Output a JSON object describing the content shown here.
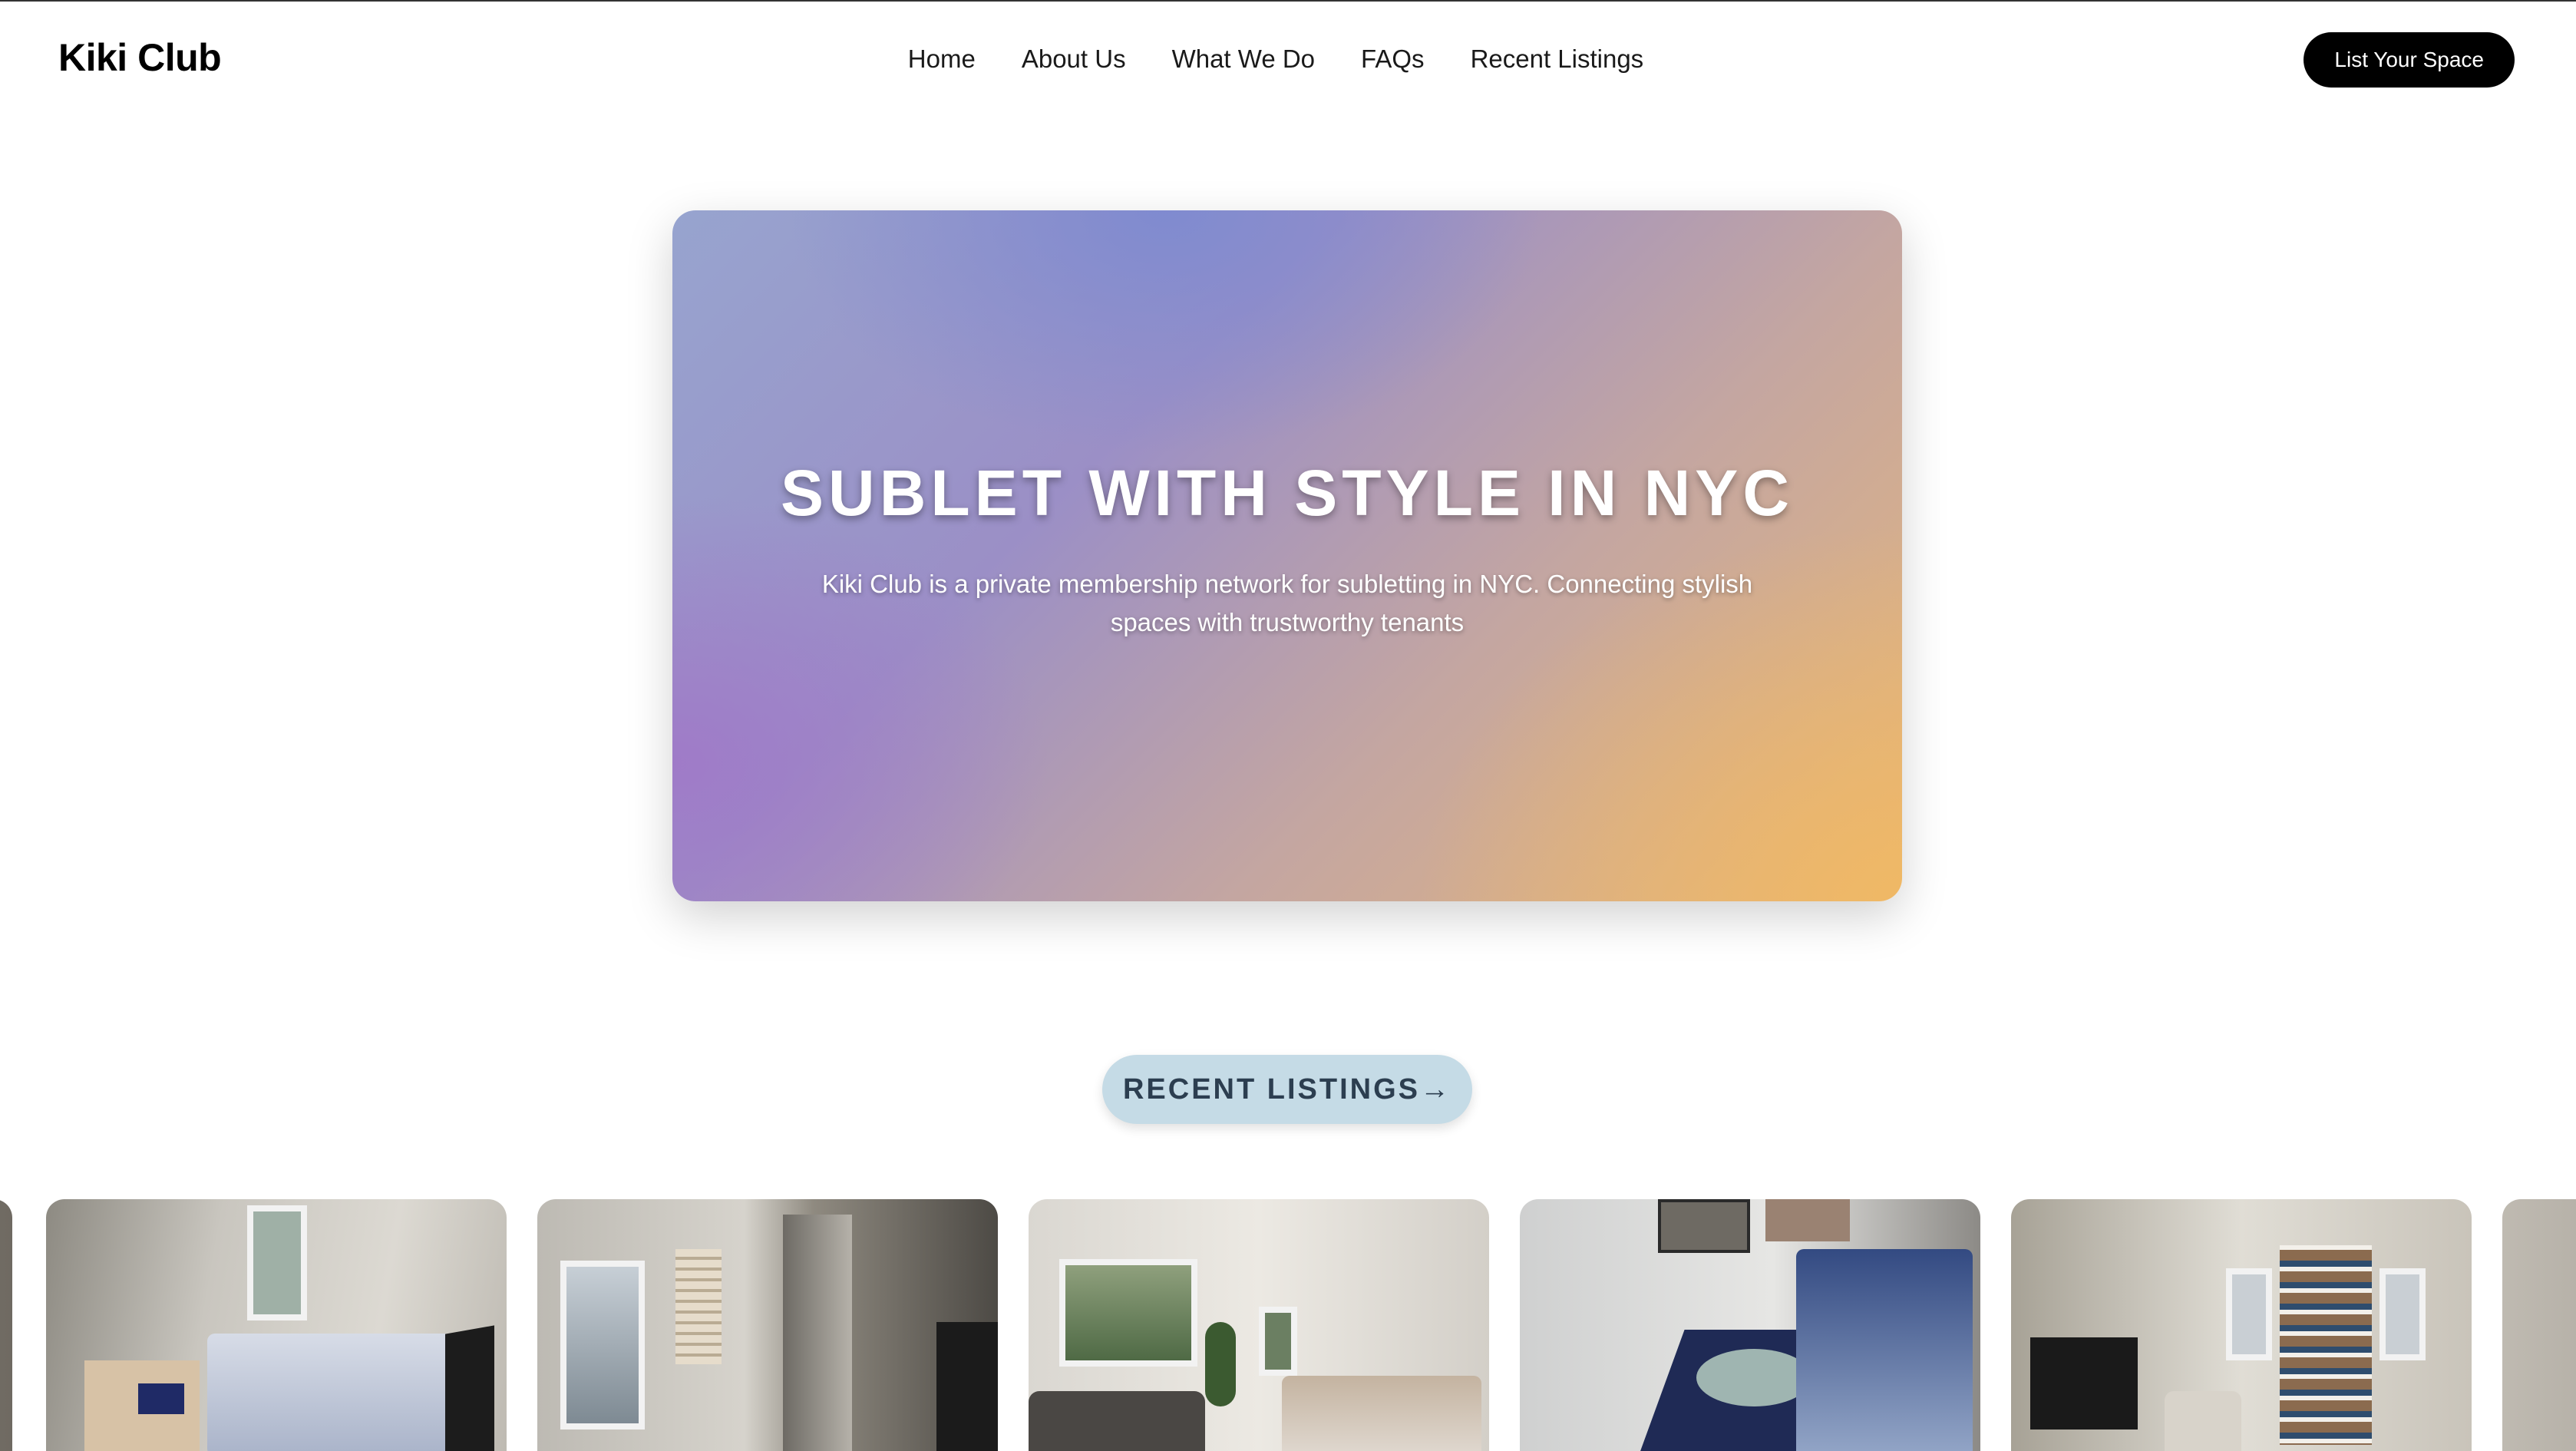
{
  "header": {
    "logo": "Kiki Club",
    "nav": [
      "Home",
      "About Us",
      "What We Do",
      "FAQs",
      "Recent Listings"
    ],
    "cta_label": "List Your Space"
  },
  "hero": {
    "title": "SUBLET WITH STYLE IN NYC",
    "subtitle": "Kiki Club is a private membership network for subletting in NYC. Connecting stylish spaces with trustworthy tenants"
  },
  "recent": {
    "label": "RECENT LISTINGS→"
  },
  "listings": [
    {
      "name": "listing-photo-bedroom-small"
    },
    {
      "name": "listing-photo-bedroom-window"
    },
    {
      "name": "listing-photo-living-room"
    },
    {
      "name": "listing-photo-blue-bedroom"
    },
    {
      "name": "listing-photo-living-bookshelf"
    }
  ],
  "colors": {
    "cta_bg": "#000000",
    "pill_bg": "#c5dbe6",
    "pill_text": "#2c3e50",
    "hero_gradient": [
      "#97a4cf",
      "#9b8fc6",
      "#c4a6a1",
      "#e6b67a"
    ]
  }
}
